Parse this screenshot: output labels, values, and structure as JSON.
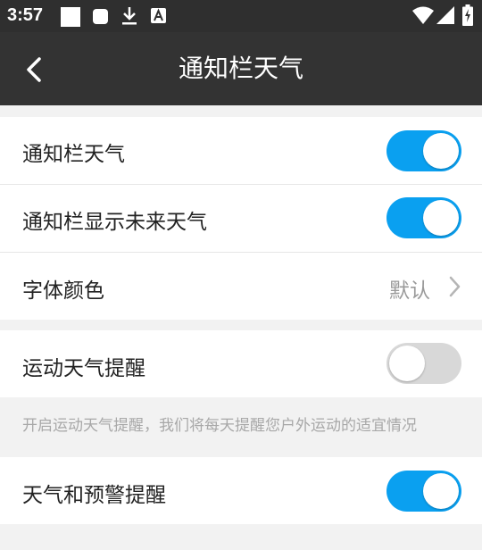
{
  "status_bar": {
    "time": "3:57",
    "left_icons": [
      "notification-square-icon",
      "rounded-square-icon",
      "download-icon",
      "font-a-icon"
    ],
    "right_icons": [
      "wifi-icon",
      "signal-icon",
      "battery-charging-icon"
    ]
  },
  "header": {
    "title": "通知栏天气",
    "back_icon": "chevron-left-icon"
  },
  "settings": {
    "notification_weather": {
      "label": "通知栏天气",
      "enabled": true
    },
    "future_weather": {
      "label": "通知栏显示未来天气",
      "enabled": true
    },
    "font_color": {
      "label": "字体颜色",
      "value": "默认"
    },
    "sport_weather": {
      "label": "运动天气提醒",
      "enabled": false
    },
    "sport_hint": "开启运动天气提醒，我们将每天提醒您户外运动的适宜情况",
    "warning": {
      "label": "天气和预警提醒",
      "enabled": true
    }
  },
  "colors": {
    "accent": "#0aa0f0",
    "toolbar": "#333333",
    "background": "#f2f2f2",
    "toggle_off": "#d8d8d8"
  }
}
